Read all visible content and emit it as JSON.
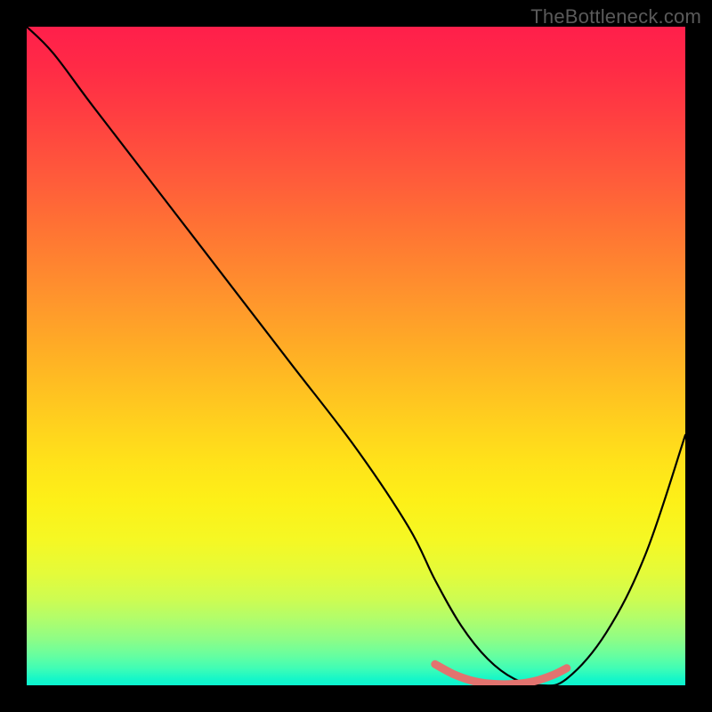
{
  "watermark": "TheBottleneck.com",
  "chart_data": {
    "type": "line",
    "title": "",
    "xlabel": "",
    "ylabel": "",
    "xlim": [
      0,
      100
    ],
    "ylim": [
      0,
      100
    ],
    "series": [
      {
        "name": "bottleneck-curve",
        "x": [
          0,
          4,
          10,
          20,
          30,
          40,
          50,
          58,
          62,
          66,
          70,
          74,
          78,
          82,
          88,
          94,
          100
        ],
        "y": [
          100,
          96,
          88,
          75,
          62,
          49,
          36,
          24,
          16,
          9,
          4,
          1,
          0,
          1,
          8,
          20,
          38
        ]
      }
    ],
    "highlight_segment": {
      "name": "optimal-zone",
      "x": [
        62,
        65,
        68,
        71,
        74,
        77,
        80,
        82
      ],
      "y": [
        3.2,
        1.6,
        0.6,
        0.2,
        0.2,
        0.6,
        1.6,
        2.6
      ]
    },
    "gradient_stops": [
      {
        "pos": 0.0,
        "color": "#ff1f4b"
      },
      {
        "pos": 0.5,
        "color": "#ffaa26"
      },
      {
        "pos": 0.78,
        "color": "#f5f824"
      },
      {
        "pos": 1.0,
        "color": "#0cf4cf"
      }
    ]
  }
}
